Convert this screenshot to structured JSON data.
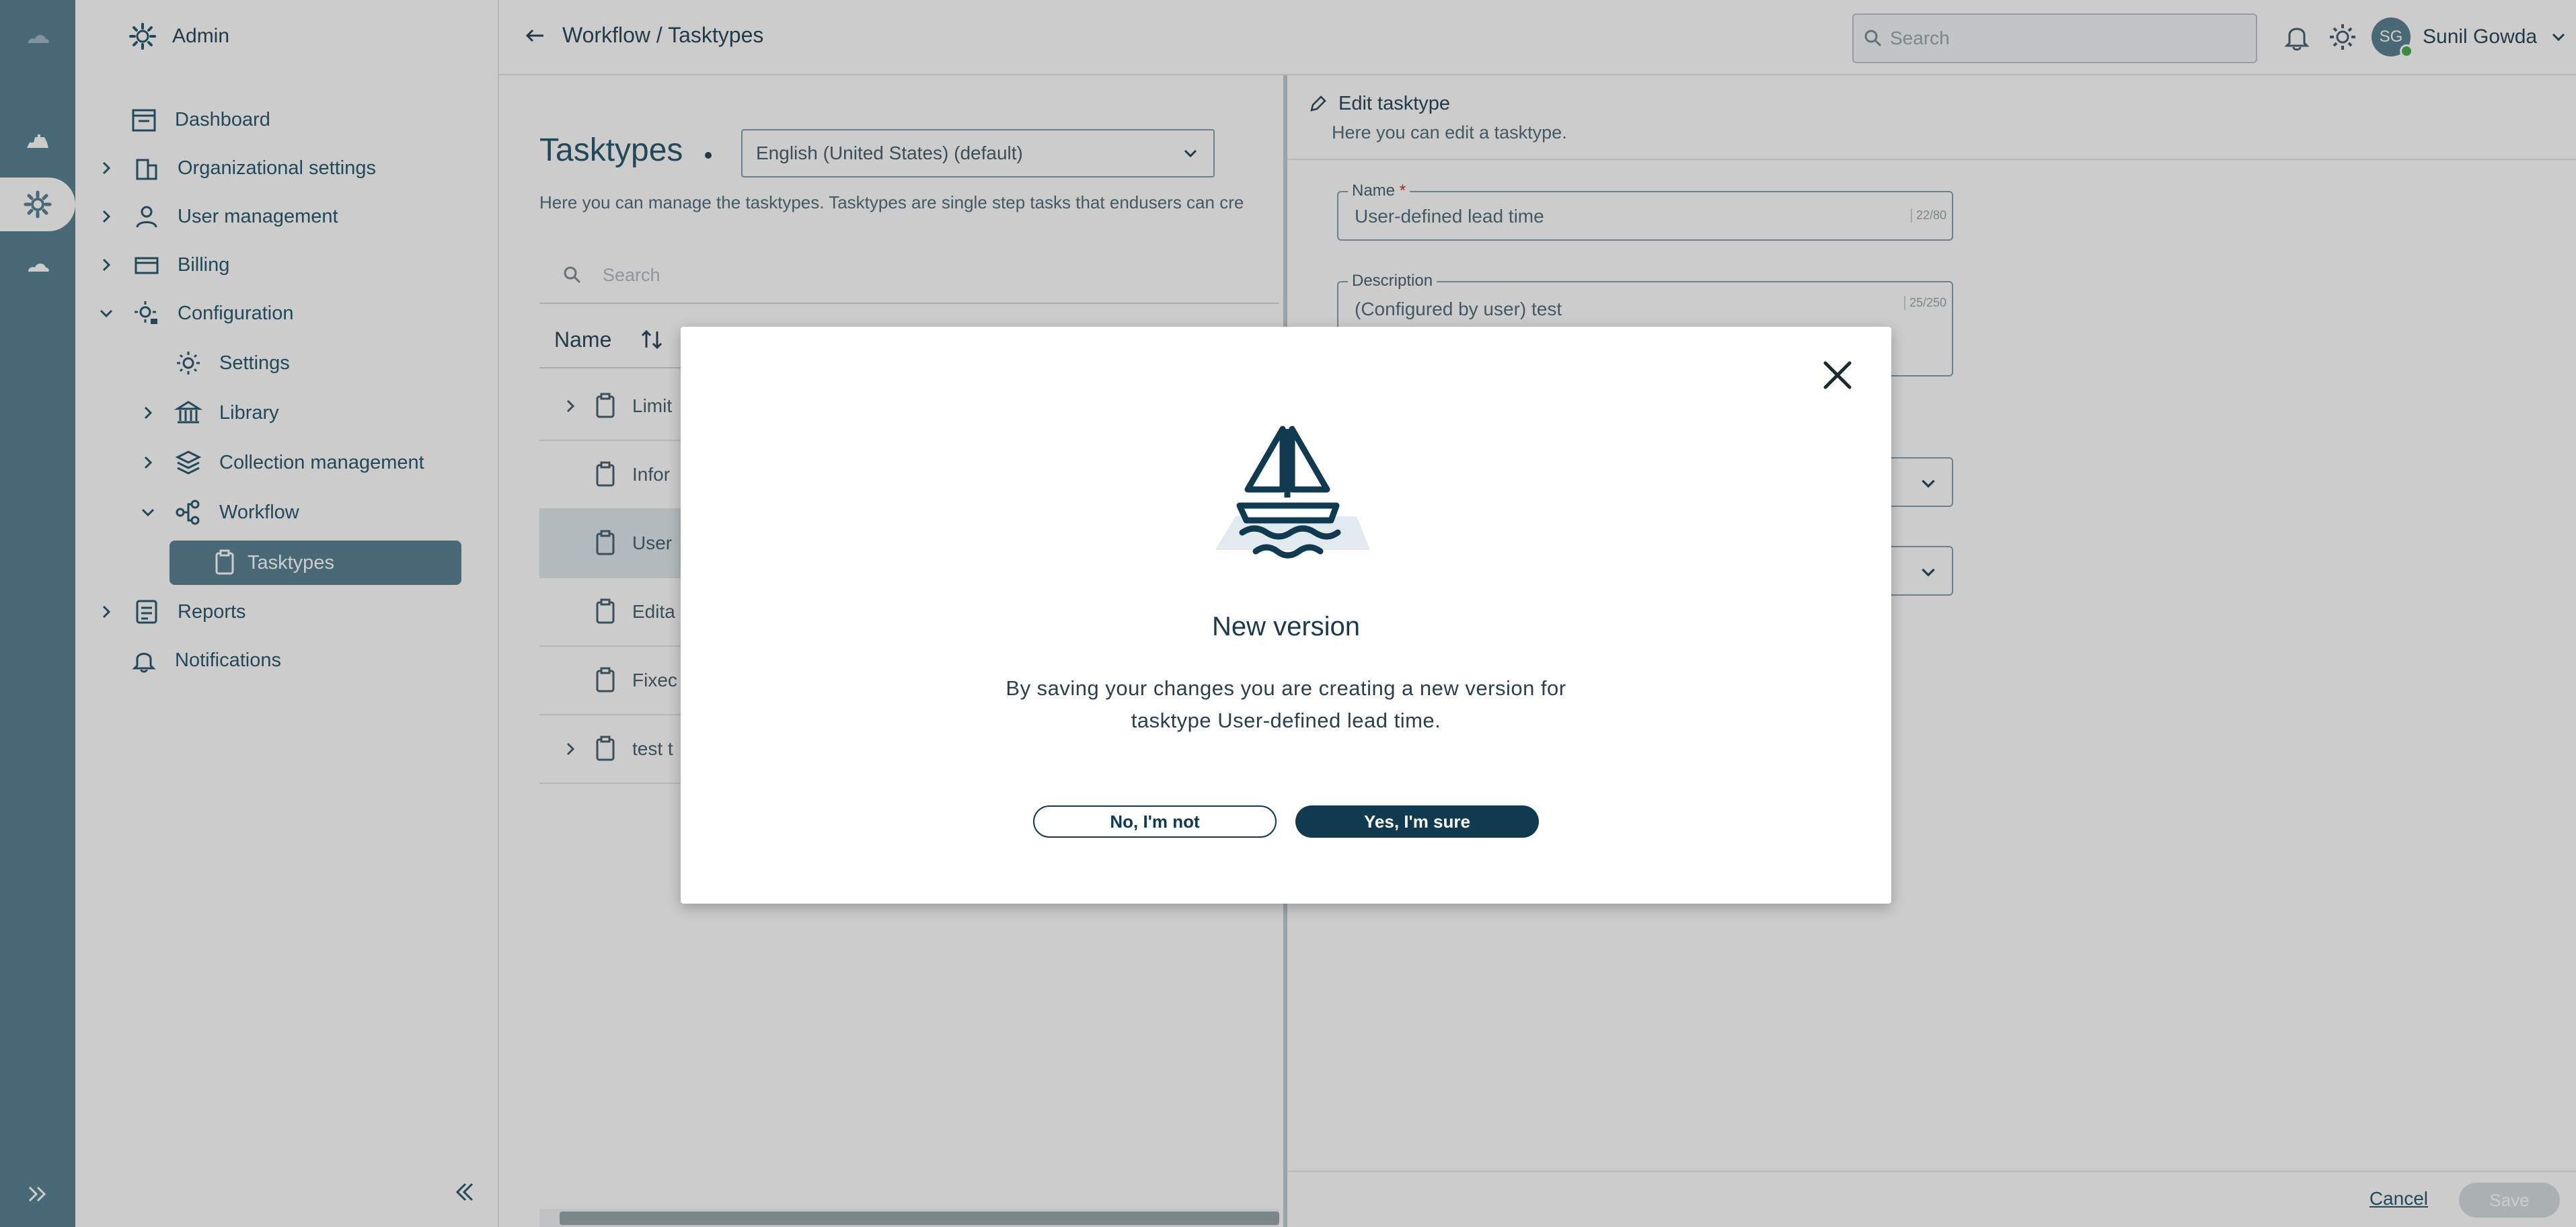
{
  "sidebar": {
    "header": "Admin",
    "items": [
      {
        "label": "Dashboard"
      },
      {
        "label": "Organizational settings"
      },
      {
        "label": "User management"
      },
      {
        "label": "Billing"
      },
      {
        "label": "Configuration"
      },
      {
        "label": "Settings"
      },
      {
        "label": "Library"
      },
      {
        "label": "Collection management"
      },
      {
        "label": "Workflow"
      },
      {
        "label": "Tasktypes"
      },
      {
        "label": "Reports"
      },
      {
        "label": "Notifications"
      }
    ]
  },
  "topbar": {
    "breadcrumb": "Workflow / Tasktypes",
    "search_placeholder": "Search",
    "avatar_initials": "SG",
    "user_name": "Sunil Gowda"
  },
  "main": {
    "title": "Tasktypes",
    "language": "English (United States) (default)",
    "description": "Here you can manage the tasktypes. Tasktypes are single step tasks that endusers can cre",
    "search_placeholder": "Search",
    "column_name": "Name",
    "rows": [
      {
        "label": "Limit",
        "expandable": true
      },
      {
        "label": "Infor",
        "expandable": false
      },
      {
        "label": "User",
        "expandable": false
      },
      {
        "label": "Edita",
        "expandable": false
      },
      {
        "label": "Fixec",
        "expandable": false
      },
      {
        "label": "test t",
        "expandable": true
      }
    ]
  },
  "panel": {
    "title": "Edit tasktype",
    "subtitle": "Here you can edit a tasktype.",
    "name_label": "Name",
    "name_required": "*",
    "name_value": "User-defined lead time",
    "name_count": "22/80",
    "description_label": "Description",
    "description_value": "(Configured by user) test",
    "description_count": "25/250",
    "cancel_label": "Cancel",
    "save_label": "Save"
  },
  "modal": {
    "title": "New version",
    "message": "By saving your changes you are creating a new version for tasktype User-defined lead time.",
    "no_label": "No, I'm not",
    "yes_label": "Yes, I'm sure"
  },
  "colors": {
    "rail": "#5c8495",
    "primary_dark": "#0f3a50",
    "selected_item": "#5c8495"
  }
}
